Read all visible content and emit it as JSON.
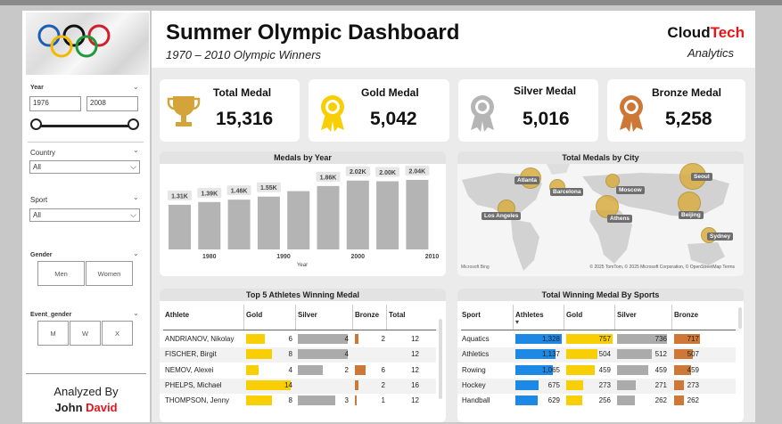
{
  "colors": {
    "gold": "#f8ce05",
    "silver": "#ababab",
    "bronze": "#cd7836",
    "athletes": "#1e88e5",
    "brand_red": "#e8141a",
    "bar_grey": "#b4b4b4",
    "bubble": "#d8ad42"
  },
  "slicers": {
    "year": {
      "label": "Year",
      "from": "1976",
      "to": "2008"
    },
    "country": {
      "label": "Country",
      "value": "All"
    },
    "sport": {
      "label": "Sport",
      "value": "All"
    },
    "gender": {
      "label": "Gender",
      "options": [
        "Men",
        "Women"
      ]
    },
    "event_gender": {
      "label": "Event_gender",
      "options": [
        "M",
        "W",
        "X"
      ]
    },
    "analyzed": {
      "label": "Analyzed By",
      "first": "John",
      "last": "David"
    }
  },
  "header": {
    "title": "Summer Olympic Dashboard",
    "subtitle": "1970 – 2010 Olympic Winners",
    "brand_a": "Cloud",
    "brand_b": "Tech",
    "brand_sub": "Analytics"
  },
  "kpis": [
    {
      "label": "Total Medal",
      "value": "15,316",
      "icon": "trophy-icon"
    },
    {
      "label": "Gold Medal",
      "value": "5,042",
      "icon": "gold-medal-icon"
    },
    {
      "label": "Silver Medal",
      "value": "5,016",
      "icon": "silver-medal-icon"
    },
    {
      "label": "Bronze Medal",
      "value": "5,258",
      "icon": "bronze-medal-icon"
    }
  ],
  "medals_by_year": {
    "title": "Medals by Year",
    "xlabel": "Year"
  },
  "city_map": {
    "title": "Total Medals by City",
    "bing": "Microsoft Bing",
    "attribution": "© 2025 TomTom, © 2025 Microsoft Corporation, © OpenStreetMap Terms"
  },
  "top_athletes": {
    "title": "Top 5 Athletes Winning Medal",
    "headers": [
      "Athlete",
      "Gold",
      "Silver",
      "Bronze",
      "Total"
    ],
    "rows": [
      {
        "name": "ANDRIANOV, Nikolay",
        "gold": 6,
        "silver": 4,
        "bronze": 2,
        "total": 12
      },
      {
        "name": "FISCHER, Birgit",
        "gold": 8,
        "silver": 4,
        "bronze": "",
        "total": 12
      },
      {
        "name": "NEMOV, Alexei",
        "gold": 4,
        "silver": 2,
        "bronze": 6,
        "total": 12
      },
      {
        "name": "PHELPS, Michael",
        "gold": 14,
        "silver": "",
        "bronze": 2,
        "total": 16
      },
      {
        "name": "THOMPSON, Jenny",
        "gold": 8,
        "silver": 3,
        "bronze": 1,
        "total": 12
      }
    ]
  },
  "sports": {
    "title": "Total Winning Medal By Sports",
    "headers": [
      "Sport",
      "Athletes",
      "Gold",
      "Silver",
      "Bronze"
    ],
    "rows": [
      {
        "name": "Aquatics",
        "athletes": "1,328",
        "gold": 757,
        "silver": 736,
        "bronze": 717,
        "a": 1328
      },
      {
        "name": "Athletics",
        "athletes": "1,137",
        "gold": 504,
        "silver": 512,
        "bronze": 507,
        "a": 1137
      },
      {
        "name": "Rowing",
        "athletes": "1,065",
        "gold": 459,
        "silver": 459,
        "bronze": 459,
        "a": 1065
      },
      {
        "name": "Hockey",
        "athletes": "675",
        "gold": 273,
        "silver": 271,
        "bronze": 273,
        "a": 675
      },
      {
        "name": "Handball",
        "athletes": "629",
        "gold": 256,
        "silver": 262,
        "bronze": 262,
        "a": 629
      }
    ]
  },
  "chart_data": [
    {
      "type": "bar",
      "title": "Medals by Year",
      "xlabel": "Year",
      "categories": [
        "1976",
        "1980",
        "1984",
        "1988",
        "1992",
        "1996",
        "2000",
        "2004",
        "2008"
      ],
      "values": [
        1310,
        1390,
        1460,
        1550,
        1710,
        1860,
        2020,
        2000,
        2040
      ],
      "data_labels": [
        "1.31K",
        "1.39K",
        "1.46K",
        "1.55K",
        "",
        "1.86K",
        "2.02K",
        "2.00K",
        "2.04K"
      ],
      "x_ticks": [
        "1980",
        "1990",
        "2000",
        "2010"
      ],
      "ylim": [
        0,
        2300
      ]
    },
    {
      "type": "scatter",
      "title": "Total Medals by City",
      "points": [
        {
          "label": "Atlanta"
        },
        {
          "label": "Barcelona"
        },
        {
          "label": "Moscow"
        },
        {
          "label": "Los Angeles"
        },
        {
          "label": "Athens"
        },
        {
          "label": "Seoul"
        },
        {
          "label": "Beijing"
        },
        {
          "label": "Sydney"
        }
      ]
    }
  ]
}
